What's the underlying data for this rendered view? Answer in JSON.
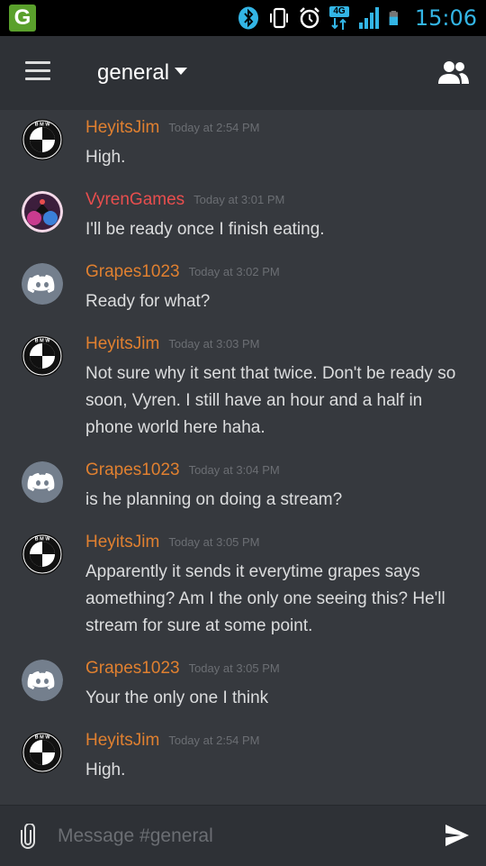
{
  "status_bar": {
    "carrier_badge": "G",
    "network_label": "4G",
    "time": "15:06",
    "icons": [
      "bluetooth-icon",
      "vibrate-icon",
      "alarm-icon",
      "network-4g-icon",
      "signal-icon",
      "battery-icon"
    ]
  },
  "app_bar": {
    "channel_name": "general",
    "menu_icon": "hamburger-menu-icon",
    "members_icon": "members-icon"
  },
  "messages": [
    {
      "author": "HeyitsJim",
      "author_color": "#e08030",
      "avatar": "bmw",
      "timestamp": "Today at 2:54 PM",
      "text": "High."
    },
    {
      "author": "VyrenGames",
      "author_color": "#e84e4e",
      "avatar": "vyren",
      "timestamp": "Today at 3:01 PM",
      "text": "I'll be ready once I finish eating."
    },
    {
      "author": "Grapes1023",
      "author_color": "#e08030",
      "avatar": "discord",
      "timestamp": "Today at 3:02 PM",
      "text": "Ready for what?"
    },
    {
      "author": "HeyitsJim",
      "author_color": "#e08030",
      "avatar": "bmw",
      "timestamp": "Today at 3:03 PM",
      "text": "Not sure why it sent that twice. Don't be ready so soon, Vyren. I still have an hour and a half in phone world here haha."
    },
    {
      "author": "Grapes1023",
      "author_color": "#e08030",
      "avatar": "discord",
      "timestamp": "Today at 3:04 PM",
      "text": "is he planning on doing a stream?"
    },
    {
      "author": "HeyitsJim",
      "author_color": "#e08030",
      "avatar": "bmw",
      "timestamp": "Today at 3:05 PM",
      "text": "Apparently it sends it everytime grapes says aomething? Am I the only one seeing this? He'll stream for sure at some point."
    },
    {
      "author": "Grapes1023",
      "author_color": "#e08030",
      "avatar": "discord",
      "timestamp": "Today at 3:05 PM",
      "text": "Your the only one I think"
    },
    {
      "author": "HeyitsJim",
      "author_color": "#e08030",
      "avatar": "bmw",
      "timestamp": "Today at 2:54 PM",
      "text": "High."
    }
  ],
  "composer": {
    "placeholder": "Message #general",
    "value": "",
    "attach_icon": "paperclip-icon",
    "send_icon": "send-icon"
  },
  "colors": {
    "background": "#36393e",
    "app_bar": "#2e3136",
    "author_orange": "#e08030",
    "author_red": "#e84e4e",
    "timestamp": "#6b6e73",
    "status_icon_blue": "#33b5e5"
  }
}
